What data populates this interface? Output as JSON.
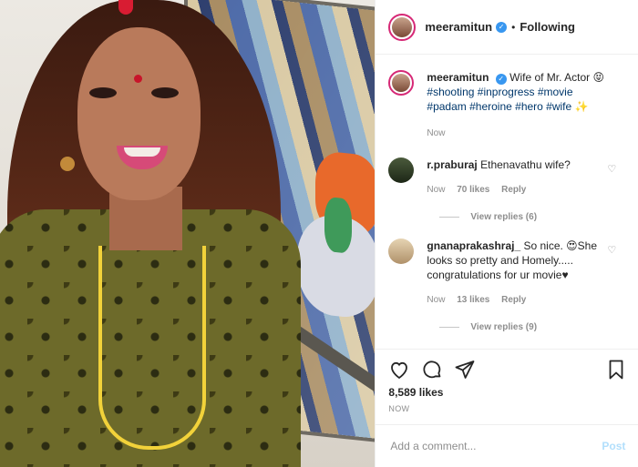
{
  "header": {
    "username": "meeramitun",
    "verified_icon": "verified-check-icon",
    "separator": "•",
    "follow_status": "Following"
  },
  "caption": {
    "username": "meeramitun",
    "text_prefix": "Wife of Mr. Actor 😝",
    "hashtags_line1": "#shooting #inprogress #movie",
    "hashtags_line2": "#padam #heroine #hero #wife ✨",
    "time": "Now"
  },
  "comments": [
    {
      "username": "r.praburaj",
      "text": "Ethenavathu wife?",
      "time": "Now",
      "likes": "70 likes",
      "reply": "Reply",
      "view_replies": "View replies (6)"
    },
    {
      "username": "gnanaprakashraj_",
      "text": "So nice. 😍She looks so pretty and Homely..... congratulations for ur movie♥",
      "time": "Now",
      "likes": "13 likes",
      "reply": "Reply",
      "view_replies": "View replies (9)"
    }
  ],
  "actions": {
    "like_icon": "heart-icon",
    "comment_icon": "comment-icon",
    "share_icon": "share-icon",
    "save_icon": "bookmark-icon",
    "likes": "8,589 likes",
    "time": "NOW"
  },
  "add_comment": {
    "placeholder": "Add a comment...",
    "post_label": "Post"
  },
  "colors": {
    "accent": "#3897f0",
    "post_disabled": "#b2dffc",
    "avatar_ring": "#d62976"
  }
}
